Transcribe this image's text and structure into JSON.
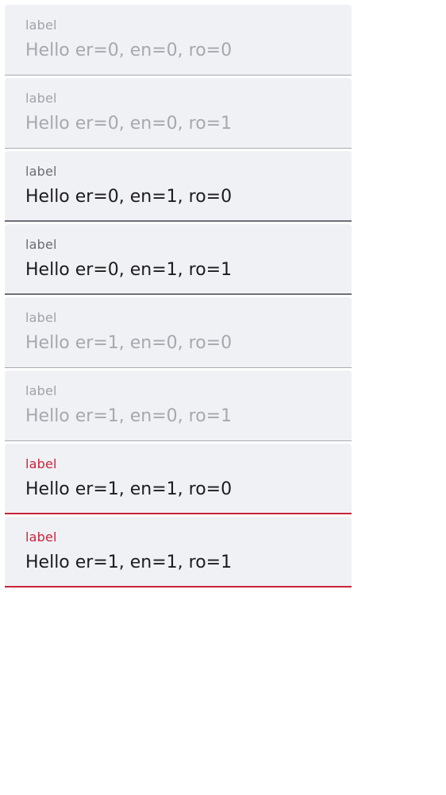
{
  "fields": [
    {
      "label": "label",
      "value": "Hello er=0, en=0, ro=0",
      "state": "disabled"
    },
    {
      "label": "label",
      "value": "Hello er=0, en=0, ro=1",
      "state": "disabled"
    },
    {
      "label": "label",
      "value": "Hello er=0, en=1, ro=0",
      "state": "enabled"
    },
    {
      "label": "label",
      "value": "Hello er=0, en=1, ro=1",
      "state": "enabled"
    },
    {
      "label": "label",
      "value": "Hello er=1, en=0, ro=0",
      "state": "disabled"
    },
    {
      "label": "label",
      "value": "Hello er=1, en=0, ro=1",
      "state": "disabled"
    },
    {
      "label": "label",
      "value": "Hello er=1, en=1, ro=0",
      "state": "error"
    },
    {
      "label": "label",
      "value": "Hello er=1, en=1, ro=1",
      "state": "error"
    }
  ],
  "colors": {
    "field_background": "#f0f1f5",
    "disabled_text": "#a7a8ae",
    "enabled_text": "#1c1c1f",
    "error": "#c8243a"
  }
}
